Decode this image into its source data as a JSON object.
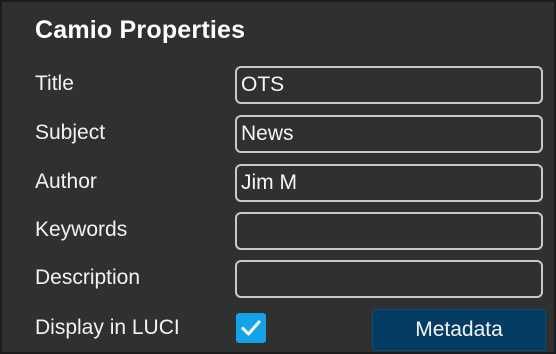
{
  "panel": {
    "title": "Camio Properties"
  },
  "fields": {
    "title": {
      "label": "Title",
      "value": "OTS"
    },
    "subject": {
      "label": "Subject",
      "value": "News"
    },
    "author": {
      "label": "Author",
      "value": "Jim M"
    },
    "keywords": {
      "label": "Keywords",
      "value": ""
    },
    "description": {
      "label": "Description",
      "value": ""
    }
  },
  "display_in_luci": {
    "label": "Display in LUCI",
    "checked": true
  },
  "metadata_button": {
    "label": "Metadata"
  },
  "colors": {
    "panel_bg": "#2f3030",
    "checkbox_accent": "#14a3e6",
    "button_bg": "#053c63"
  },
  "icons": {
    "checkbox": "checkmark-icon"
  }
}
